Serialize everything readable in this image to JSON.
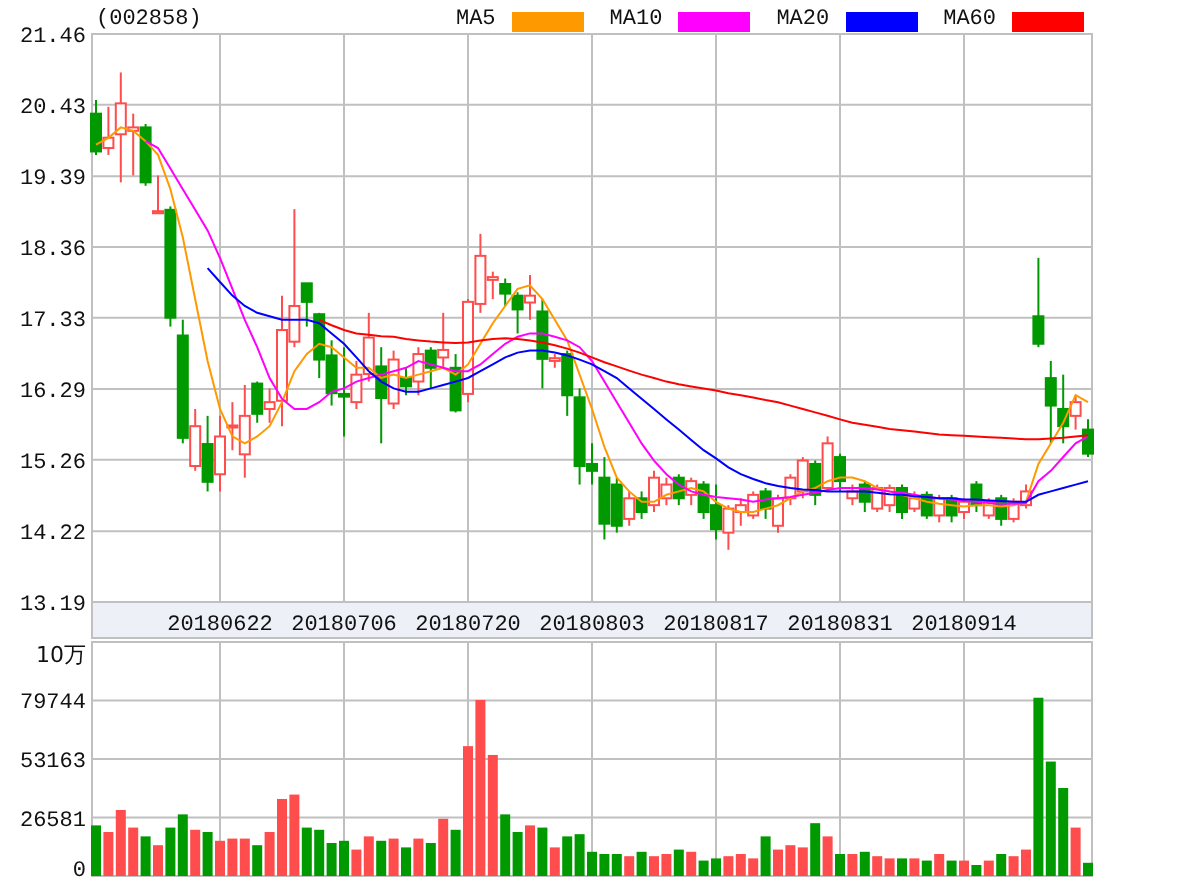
{
  "price_chart": {
    "chart_data": {
      "type": "candlestick",
      "title": "(002858)",
      "grid": true,
      "legend": true,
      "ylim": [
        13.19,
        21.46
      ],
      "yticks": [
        13.19,
        14.22,
        15.26,
        16.29,
        17.33,
        18.36,
        19.39,
        20.43,
        21.46
      ],
      "categories": [
        null,
        null,
        null,
        null,
        null,
        null,
        null,
        null,
        null,
        null,
        "20180622",
        null,
        null,
        null,
        null,
        null,
        null,
        null,
        null,
        null,
        "20180706",
        null,
        null,
        null,
        null,
        null,
        null,
        null,
        null,
        null,
        "20180720",
        null,
        null,
        null,
        null,
        null,
        null,
        null,
        null,
        null,
        "20180803",
        null,
        null,
        null,
        null,
        null,
        null,
        null,
        null,
        null,
        "20180817",
        null,
        null,
        null,
        null,
        null,
        null,
        null,
        null,
        null,
        "20180831",
        null,
        null,
        null,
        null,
        null,
        null,
        null,
        null,
        null,
        "20180914",
        null,
        null,
        null,
        null,
        null,
        null,
        null,
        null,
        null,
        null
      ],
      "ohlc": [
        [
          20.3,
          20.5,
          19.7,
          19.75
        ],
        [
          19.8,
          20.4,
          19.7,
          19.95
        ],
        [
          20.0,
          20.9,
          19.3,
          20.45
        ],
        [
          20.05,
          20.3,
          19.4,
          20.1
        ],
        [
          20.1,
          20.15,
          19.25,
          19.3
        ],
        [
          18.85,
          19.4,
          18.85,
          18.88
        ],
        [
          18.9,
          18.95,
          17.2,
          17.33
        ],
        [
          17.07,
          17.3,
          15.5,
          15.58
        ],
        [
          15.17,
          16.0,
          15.1,
          15.75
        ],
        [
          15.49,
          15.9,
          14.8,
          14.94
        ],
        [
          15.05,
          15.9,
          14.8,
          15.6
        ],
        [
          15.74,
          16.1,
          15.4,
          15.76
        ],
        [
          15.34,
          16.35,
          15.0,
          15.9
        ],
        [
          16.37,
          16.4,
          15.8,
          15.93
        ],
        [
          16.0,
          16.3,
          15.8,
          16.1
        ],
        [
          16.12,
          17.65,
          15.75,
          17.15
        ],
        [
          16.98,
          18.91,
          16.9,
          17.5
        ],
        [
          17.83,
          17.83,
          17.2,
          17.56
        ],
        [
          17.38,
          17.4,
          16.45,
          16.72
        ],
        [
          16.78,
          17.0,
          16.05,
          16.23
        ],
        [
          16.22,
          16.9,
          15.6,
          16.18
        ],
        [
          16.1,
          16.7,
          16.0,
          16.5
        ],
        [
          16.51,
          17.4,
          16.4,
          17.04
        ],
        [
          16.62,
          16.9,
          15.5,
          16.16
        ],
        [
          16.08,
          16.85,
          16.0,
          16.72
        ],
        [
          16.45,
          16.6,
          16.2,
          16.33
        ],
        [
          16.4,
          16.9,
          16.2,
          16.8
        ],
        [
          16.85,
          16.9,
          16.3,
          16.6
        ],
        [
          16.75,
          17.4,
          16.6,
          16.86
        ],
        [
          16.6,
          16.8,
          15.95,
          15.98
        ],
        [
          16.22,
          17.6,
          16.1,
          17.56
        ],
        [
          17.53,
          18.55,
          17.4,
          18.23
        ],
        [
          17.88,
          18.0,
          17.6,
          17.92
        ],
        [
          17.82,
          17.9,
          17.5,
          17.68
        ],
        [
          17.65,
          17.7,
          17.1,
          17.45
        ],
        [
          17.55,
          17.95,
          17.3,
          17.65
        ],
        [
          17.42,
          17.6,
          16.3,
          16.73
        ],
        [
          16.7,
          16.8,
          16.6,
          16.74
        ],
        [
          16.8,
          16.85,
          15.9,
          16.2
        ],
        [
          16.17,
          16.3,
          14.9,
          15.17
        ],
        [
          15.2,
          15.5,
          14.9,
          15.1
        ],
        [
          15.0,
          15.3,
          14.1,
          14.33
        ],
        [
          14.9,
          15.0,
          14.2,
          14.3
        ],
        [
          14.4,
          14.8,
          14.3,
          14.7
        ],
        [
          14.7,
          14.8,
          14.4,
          14.5
        ],
        [
          14.6,
          15.1,
          14.5,
          15.0
        ],
        [
          14.7,
          15.0,
          14.6,
          14.9
        ],
        [
          15.0,
          15.05,
          14.6,
          14.7
        ],
        [
          14.75,
          15.0,
          14.6,
          14.95
        ],
        [
          14.9,
          14.95,
          14.4,
          14.5
        ],
        [
          14.6,
          14.9,
          14.1,
          14.25
        ],
        [
          14.2,
          14.6,
          13.95,
          14.55
        ],
        [
          14.5,
          14.7,
          14.3,
          14.6
        ],
        [
          14.45,
          14.8,
          14.4,
          14.75
        ],
        [
          14.8,
          14.85,
          14.4,
          14.55
        ],
        [
          14.3,
          14.75,
          14.2,
          14.7
        ],
        [
          14.7,
          15.05,
          14.6,
          15.0
        ],
        [
          14.8,
          15.3,
          14.7,
          15.25
        ],
        [
          15.2,
          15.25,
          14.6,
          14.75
        ],
        [
          14.85,
          15.6,
          14.8,
          15.5
        ],
        [
          15.3,
          15.35,
          14.8,
          14.95
        ],
        [
          14.7,
          14.9,
          14.6,
          14.8
        ],
        [
          14.9,
          14.95,
          14.5,
          14.65
        ],
        [
          14.55,
          14.9,
          14.5,
          14.85
        ],
        [
          14.6,
          14.9,
          14.5,
          14.85
        ],
        [
          14.85,
          14.9,
          14.4,
          14.5
        ],
        [
          14.55,
          14.8,
          14.5,
          14.7
        ],
        [
          14.75,
          14.8,
          14.4,
          14.45
        ],
        [
          14.45,
          14.75,
          14.35,
          14.7
        ],
        [
          14.7,
          14.75,
          14.35,
          14.45
        ],
        [
          14.5,
          14.7,
          14.4,
          14.65
        ],
        [
          14.9,
          14.95,
          14.5,
          14.6
        ],
        [
          14.45,
          14.7,
          14.4,
          14.65
        ],
        [
          14.7,
          14.75,
          14.3,
          14.4
        ],
        [
          14.4,
          14.7,
          14.35,
          14.65
        ],
        [
          14.6,
          14.9,
          14.55,
          14.8
        ],
        [
          17.35,
          18.2,
          16.9,
          16.95
        ],
        [
          16.45,
          16.7,
          15.5,
          16.05
        ],
        [
          16.0,
          16.5,
          15.5,
          15.75
        ],
        [
          15.9,
          16.2,
          15.7,
          16.1
        ],
        [
          15.7,
          15.85,
          15.3,
          15.35
        ]
      ],
      "series": [
        {
          "name": "MA5",
          "type": "line",
          "color": "#ff9900",
          "values": [
            19.85,
            19.95,
            20.1,
            20.05,
            19.9,
            19.7,
            19.2,
            18.5,
            17.6,
            16.7,
            16.0,
            15.6,
            15.5,
            15.6,
            15.75,
            16.1,
            16.55,
            16.8,
            16.95,
            16.9,
            16.75,
            16.6,
            16.6,
            16.45,
            16.5,
            16.45,
            16.5,
            16.55,
            16.6,
            16.5,
            16.65,
            16.95,
            17.25,
            17.5,
            17.75,
            17.8,
            17.6,
            17.3,
            17.0,
            16.5,
            16.0,
            15.45,
            15.0,
            14.8,
            14.65,
            14.65,
            14.75,
            14.8,
            14.85,
            14.8,
            14.65,
            14.55,
            14.5,
            14.5,
            14.55,
            14.6,
            14.7,
            14.8,
            14.85,
            14.95,
            15.0,
            15.0,
            14.95,
            14.85,
            14.8,
            14.75,
            14.7,
            14.65,
            14.62,
            14.6,
            14.58,
            14.6,
            14.6,
            14.58,
            14.6,
            14.65,
            15.2,
            15.5,
            15.8,
            16.2,
            16.1
          ]
        },
        {
          "name": "MA10",
          "type": "line",
          "color": "#ff00ff",
          "values": [
            null,
            null,
            null,
            null,
            19.9,
            19.8,
            19.5,
            19.2,
            18.9,
            18.6,
            18.2,
            17.75,
            17.3,
            16.9,
            16.45,
            16.15,
            16.0,
            16.0,
            16.1,
            16.25,
            16.3,
            16.4,
            16.45,
            16.5,
            16.55,
            16.6,
            16.7,
            16.65,
            16.6,
            16.55,
            16.55,
            16.65,
            16.8,
            16.95,
            17.05,
            17.1,
            17.1,
            17.05,
            17.0,
            16.9,
            16.7,
            16.4,
            16.1,
            15.8,
            15.5,
            15.25,
            15.05,
            14.9,
            14.8,
            14.75,
            14.72,
            14.7,
            14.68,
            14.65,
            14.68,
            14.7,
            14.72,
            14.75,
            14.78,
            14.82,
            14.85,
            14.85,
            14.85,
            14.83,
            14.8,
            14.78,
            14.75,
            14.72,
            14.7,
            14.68,
            14.66,
            14.65,
            14.63,
            14.62,
            14.62,
            14.63,
            14.95,
            15.1,
            15.3,
            15.5,
            15.6
          ]
        },
        {
          "name": "MA20",
          "type": "line",
          "color": "#0000ff",
          "values": [
            null,
            null,
            null,
            null,
            null,
            null,
            null,
            null,
            null,
            18.05,
            17.85,
            17.65,
            17.5,
            17.4,
            17.35,
            17.3,
            17.3,
            17.3,
            17.25,
            17.1,
            16.95,
            16.75,
            16.55,
            16.4,
            16.3,
            16.25,
            16.25,
            16.3,
            16.35,
            16.4,
            16.45,
            16.55,
            16.65,
            16.75,
            16.82,
            16.85,
            16.85,
            16.82,
            16.78,
            16.72,
            16.65,
            16.55,
            16.45,
            16.3,
            16.15,
            16.0,
            15.85,
            15.7,
            15.55,
            15.4,
            15.28,
            15.15,
            15.05,
            14.98,
            14.92,
            14.88,
            14.85,
            14.83,
            14.82,
            14.8,
            14.8,
            14.8,
            14.8,
            14.78,
            14.76,
            14.75,
            14.73,
            14.72,
            14.7,
            14.7,
            14.68,
            14.68,
            14.67,
            14.66,
            14.65,
            14.65,
            14.75,
            14.8,
            14.85,
            14.9,
            14.95
          ]
        },
        {
          "name": "MA60",
          "type": "line",
          "color": "#ff0000",
          "values": [
            null,
            null,
            null,
            null,
            null,
            null,
            null,
            null,
            null,
            null,
            null,
            null,
            null,
            null,
            null,
            null,
            null,
            null,
            17.3,
            17.22,
            17.15,
            17.1,
            17.08,
            17.06,
            17.05,
            17.02,
            17.0,
            16.98,
            16.97,
            16.96,
            16.97,
            17.0,
            17.02,
            17.03,
            17.02,
            17.0,
            16.97,
            16.93,
            16.88,
            16.82,
            16.75,
            16.68,
            16.62,
            16.56,
            16.5,
            16.45,
            16.4,
            16.36,
            16.33,
            16.3,
            16.27,
            16.23,
            16.2,
            16.17,
            16.13,
            16.1,
            16.05,
            16.0,
            15.95,
            15.9,
            15.85,
            15.8,
            15.77,
            15.74,
            15.71,
            15.69,
            15.67,
            15.65,
            15.63,
            15.62,
            15.61,
            15.6,
            15.59,
            15.58,
            15.57,
            15.56,
            15.56,
            15.57,
            15.58,
            15.6,
            15.62
          ]
        }
      ]
    }
  },
  "volume_chart": {
    "chart_data": {
      "type": "bar",
      "ylabel": "10万",
      "grid": true,
      "ylim": [
        0,
        106325
      ],
      "yticks": [
        0,
        26581,
        53163,
        79744
      ],
      "series": [
        {
          "values": [
            23000,
            20000,
            30000,
            22000,
            18000,
            14000,
            22000,
            28000,
            21000,
            20000,
            16000,
            17000,
            17000,
            14000,
            20000,
            35000,
            37000,
            22000,
            21000,
            15000,
            16000,
            12000,
            18000,
            16000,
            17000,
            13000,
            17000,
            15000,
            26000,
            21000,
            59000,
            80000,
            55000,
            28000,
            20000,
            23000,
            22000,
            13000,
            18000,
            19000,
            11000,
            10000,
            10000,
            9000,
            11000,
            9000,
            10000,
            12000,
            11000,
            7000,
            8000,
            9000,
            10000,
            8000,
            18000,
            12000,
            14000,
            13000,
            24000,
            18000,
            10000,
            10000,
            11000,
            9000,
            8000,
            8000,
            8000,
            7000,
            10000,
            7000,
            7000,
            5000,
            7000,
            10000,
            9000,
            12000,
            81000,
            52000,
            40000,
            22000,
            6000
          ]
        }
      ]
    }
  }
}
